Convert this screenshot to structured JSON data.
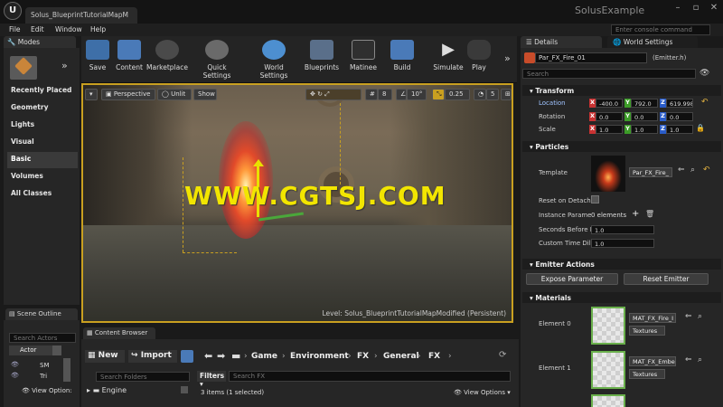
{
  "window": {
    "tab_title": "Solus_BlueprintTutorialMapM",
    "project_name": "SolusExample",
    "logo": "U"
  },
  "menu": [
    "File",
    "Edit",
    "Window",
    "Help"
  ],
  "console": {
    "placeholder": "Enter console command"
  },
  "modes": {
    "tab": "Modes",
    "items": [
      "Recently Placed",
      "Geometry",
      "Lights",
      "Visual",
      "Basic",
      "Volumes",
      "All Classes"
    ],
    "selected": "Basic"
  },
  "toolbar": [
    "Save",
    "Content",
    "Marketplace",
    "Quick Settings",
    "World Settings",
    "Blueprints",
    "Matinee",
    "Build",
    "Simulate",
    "Play"
  ],
  "viewport": {
    "perspective": "Perspective",
    "lit": "Unlit",
    "show": "Show",
    "grid": "8",
    "angle": "10°",
    "scale": "0.25",
    "speed": "5",
    "level_label": "Level:",
    "level_name": "Solus_BlueprintTutorialMapModified (Persistent)",
    "watermark": "WWW.CGTSJ.COM"
  },
  "details": {
    "tab": "Details",
    "world_tab": "World Settings",
    "actor_name": "Par_FX_Fire_01",
    "actor_class": "(Emitter.h)",
    "search_placeholder": "Search",
    "transform": {
      "title": "Transform",
      "location_label": "Location",
      "rotation_label": "Rotation",
      "scale_label": "Scale",
      "location": [
        "-400.0",
        "792.0",
        "619.998"
      ],
      "rotation": [
        "0.0",
        "0.0",
        "0.0"
      ],
      "scale": [
        "1.0",
        "1.0",
        "1.0"
      ]
    },
    "particles": {
      "title": "Particles",
      "template_label": "Template",
      "template_value": "Par_FX_Fire_",
      "reset_on_detach": "Reset on Detach",
      "instance_params": "Instance Parame",
      "instance_value": "0 elements",
      "seconds_before": "Seconds Before I",
      "seconds_value": "1.0",
      "custom_time": "Custom Time Dil",
      "custom_value": "1.0"
    },
    "emitter_actions": {
      "title": "Emitter Actions",
      "expose": "Expose Parameter",
      "reset": "Reset Emitter"
    },
    "materials": {
      "title": "Materials",
      "elements": [
        {
          "label": "Element 0",
          "material": "MAT_FX_Fire_I",
          "type": "Textures"
        },
        {
          "label": "Element 1",
          "material": "MAT_FX_Embe",
          "type": "Textures"
        }
      ]
    }
  },
  "outliner": {
    "tab": "Scene Outline",
    "search_placeholder": "Search Actors",
    "column": "Actor",
    "rows": [
      "SM",
      "Tri"
    ],
    "view_options": "View Option:"
  },
  "content_browser": {
    "tab": "Content Browser",
    "new": "New",
    "import": "Import",
    "path": [
      "Game",
      "Environment",
      "FX",
      "General",
      "FX"
    ],
    "search_folders": "Search Folders",
    "filters": "Filters",
    "search_fx": "Search FX",
    "tree_item": "Engine",
    "status": "3 items (1 selected)",
    "view_options": "View Options"
  },
  "colors": {
    "accent": "#c9a020",
    "watermark": "#f2e500",
    "x_axis": "#c83232",
    "y_axis": "#3c9c28",
    "z_axis": "#2a5cc8"
  }
}
